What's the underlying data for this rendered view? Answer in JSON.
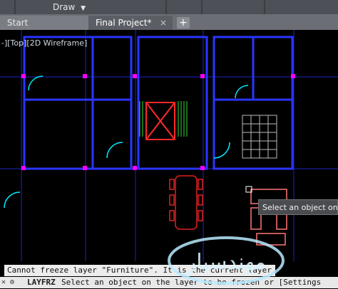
{
  "ribbon": {
    "draw_label": "Draw",
    "draw_arrow": "chevron-down-icon"
  },
  "tabs": [
    {
      "label": "Start"
    },
    {
      "label": "Final Project*",
      "close": "×"
    }
  ],
  "tab_add": "+",
  "viewport": {
    "label": "-][Top][2D Wireframe]"
  },
  "tooltip": {
    "text": "Select an object on th"
  },
  "command": {
    "history": "Cannot freeze layer \"Furniture\". It is the current layer.",
    "name": "LAYFRZ",
    "prompt": "Select an object on the layer to be frozen or [Settings"
  },
  "watermark": {
    "text": "مهندسیار"
  },
  "colors": {
    "canvas": "#000000",
    "walls": "#2233ff",
    "accent": "#ff2a2a",
    "cyan": "#00e5ff",
    "grips": "#ff00ff"
  }
}
